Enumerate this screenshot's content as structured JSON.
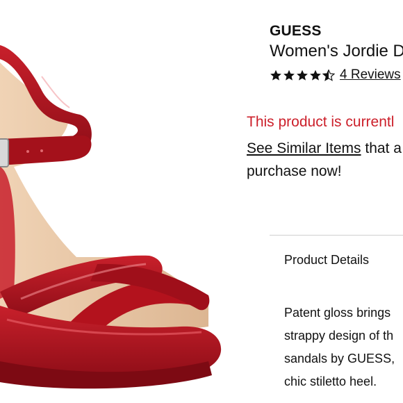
{
  "product": {
    "brand": "GUESS",
    "name": "Women's Jordie D",
    "rating": 4.5,
    "reviews_label": "4 Reviews"
  },
  "availability": {
    "message": "This product is currentl",
    "similar_link": "See Similar Items",
    "similar_rest": " that a",
    "purchase_line": "purchase now!"
  },
  "details": {
    "heading": "Product Details",
    "lines": [
      "Patent gloss brings",
      "strappy design of th",
      "sandals by GUESS,",
      "chic stiletto heel."
    ]
  },
  "colors": {
    "alert": "#cc1f2a",
    "shoe": "#b0121d",
    "lining": "#e7c4a2"
  },
  "icons": {
    "star": "star-icon",
    "half_star": "half-star-icon"
  }
}
